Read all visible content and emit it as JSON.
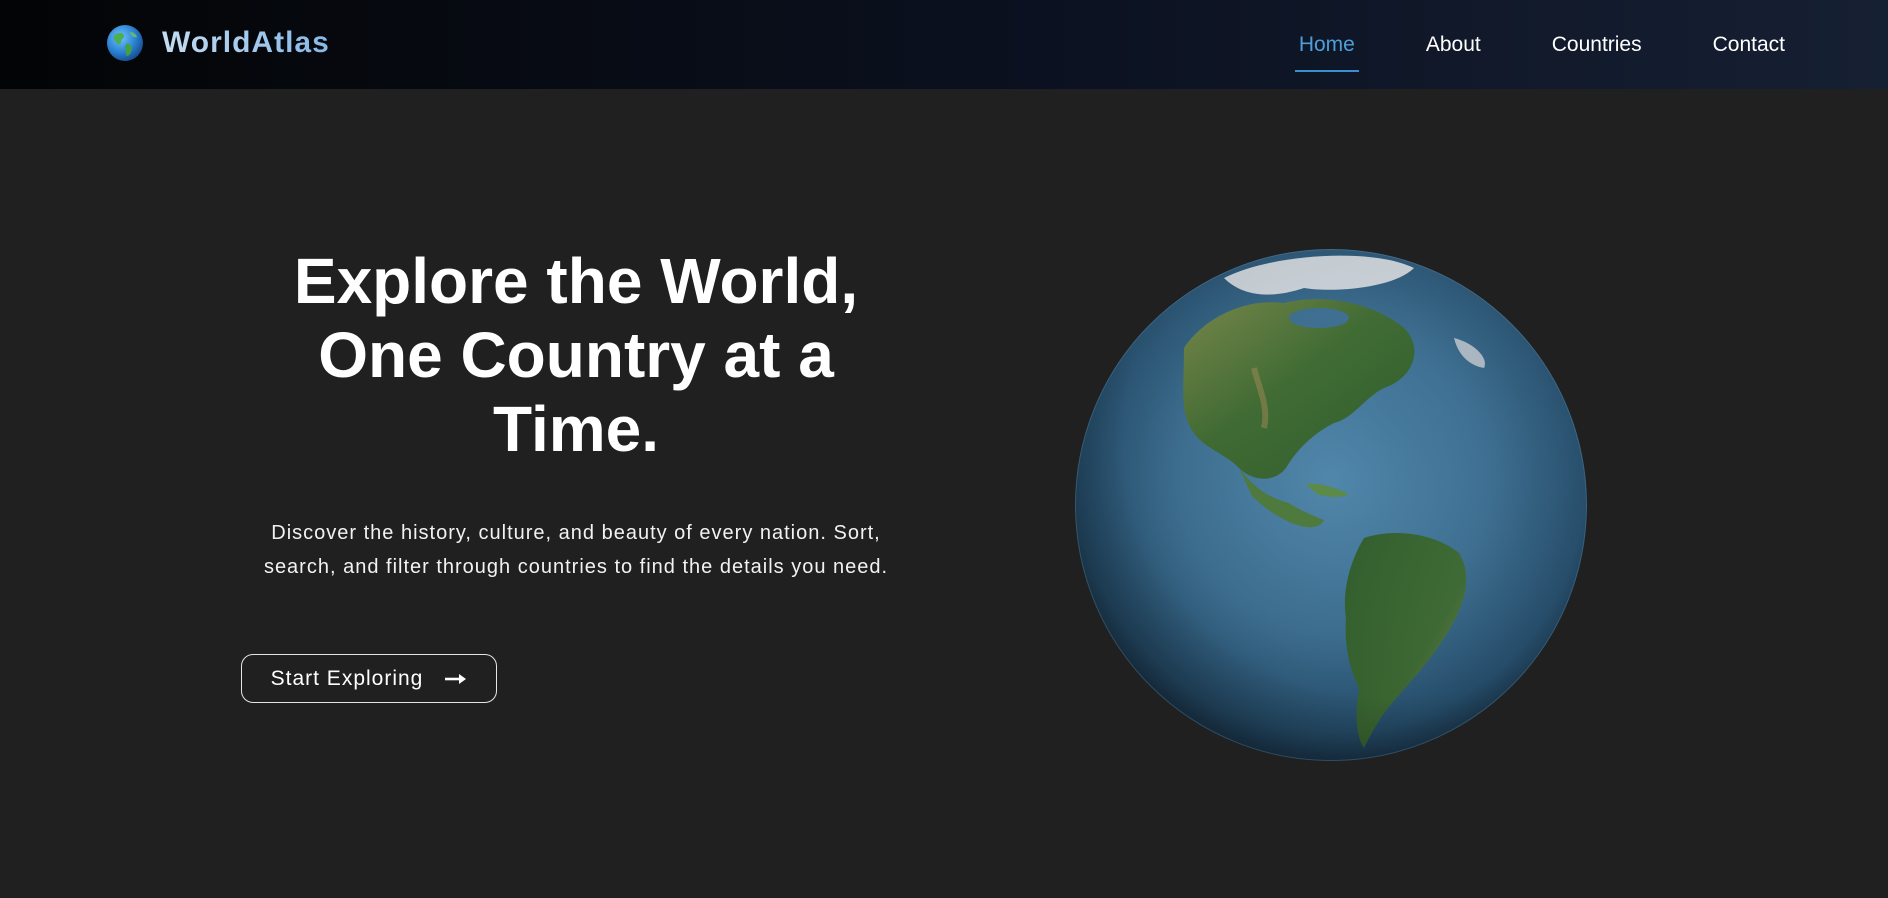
{
  "brand": {
    "name": "WorldAtlas",
    "icon": "globe-icon"
  },
  "nav": {
    "items": [
      {
        "label": "Home",
        "active": true
      },
      {
        "label": "About",
        "active": false
      },
      {
        "label": "Countries",
        "active": false
      },
      {
        "label": "Contact",
        "active": false
      }
    ]
  },
  "hero": {
    "title_lines": [
      "Explore the World,",
      "One Country at a",
      "Time."
    ],
    "subtitle": "Discover the history, culture, and beauty of every nation. Sort, search, and filter through countries to find the details you need.",
    "cta_label": "Start Exploring",
    "cta_icon": "arrow-right-icon"
  },
  "colors": {
    "page_background": "#202020",
    "nav_active": "#4d9ed9",
    "brand_gradient_start": "#c4dcf2",
    "brand_gradient_end": "#86b8e6"
  }
}
